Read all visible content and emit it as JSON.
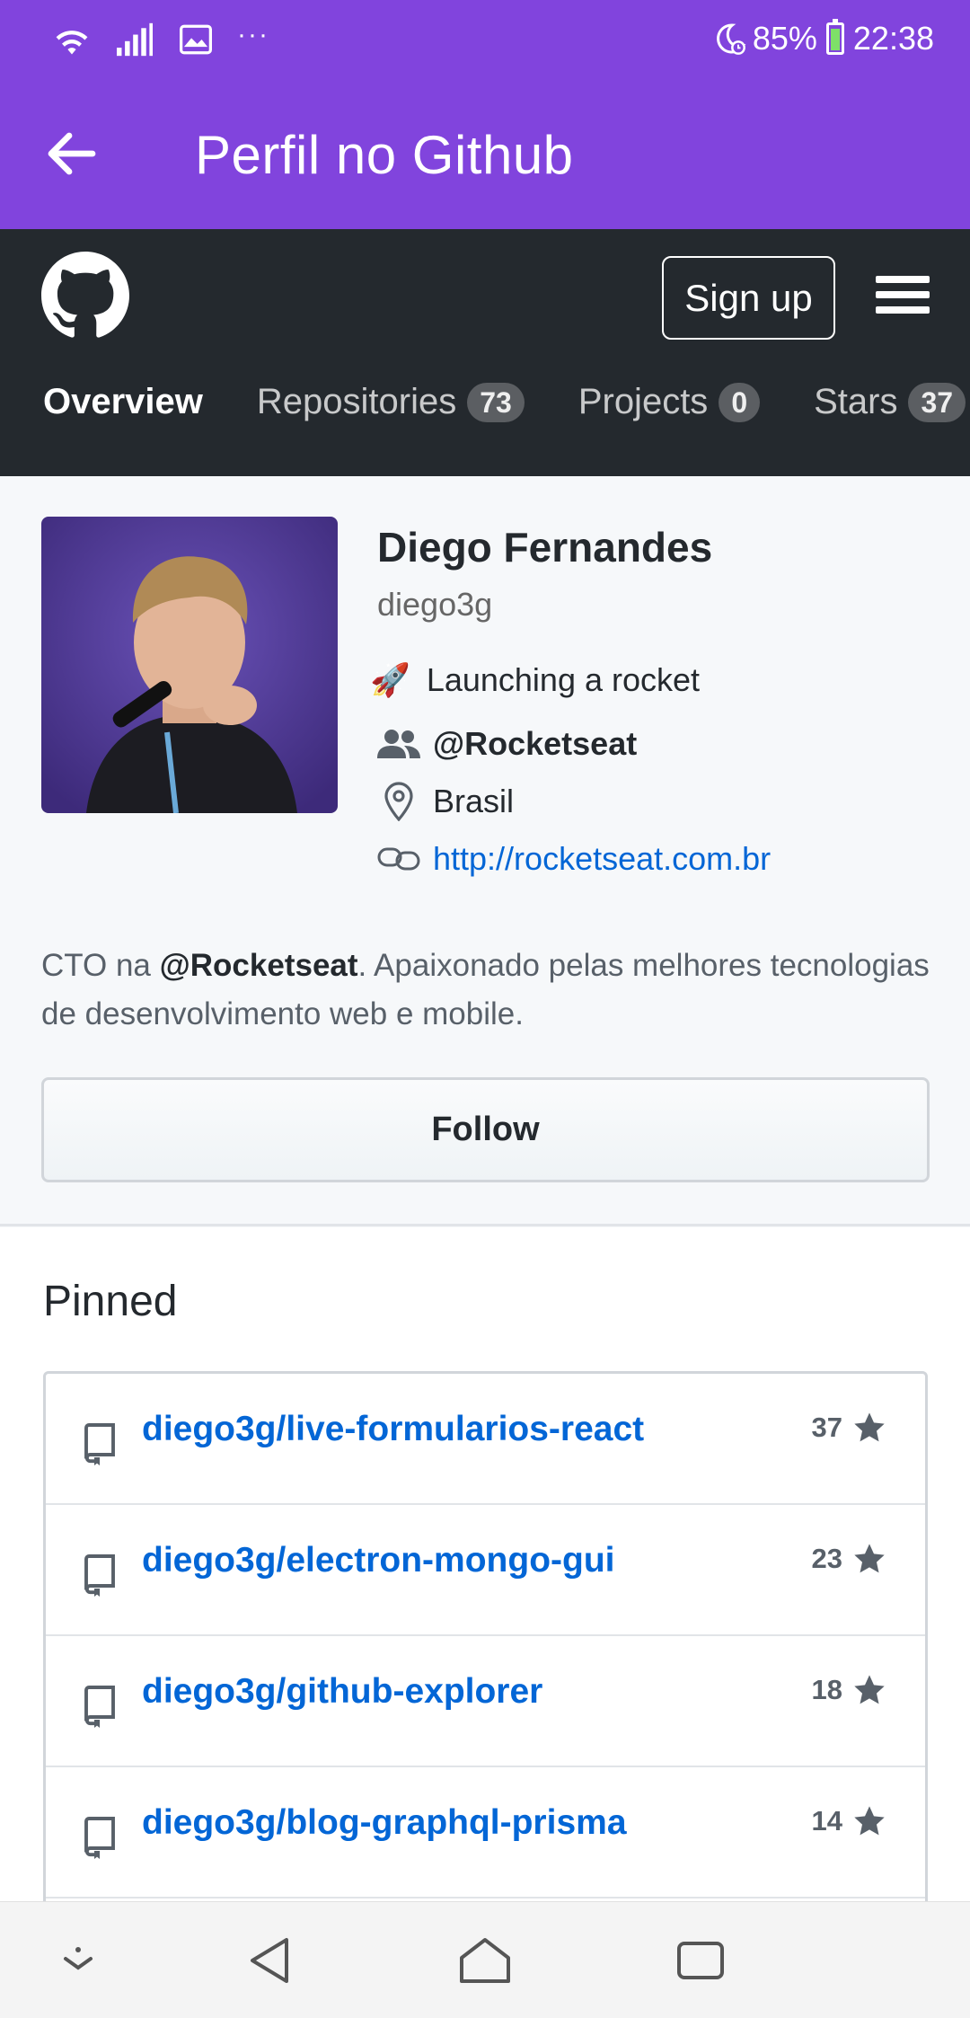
{
  "status_bar": {
    "battery_pct": "85%",
    "time": "22:38",
    "dots": "···",
    "icons": [
      "wifi-icon",
      "signal-icon",
      "image-icon",
      "more-dots-icon",
      "moon-alarm-icon",
      "battery-charging-icon"
    ]
  },
  "app_bar": {
    "title": "Perfil no Github"
  },
  "gh_header": {
    "signup_label": "Sign up",
    "nav": [
      {
        "label": "Overview",
        "count": null
      },
      {
        "label": "Repositories",
        "count": "73"
      },
      {
        "label": "Projects",
        "count": "0"
      },
      {
        "label": "Stars",
        "count": "37"
      }
    ]
  },
  "profile": {
    "name": "Diego Fernandes",
    "login": "diego3g",
    "status": "Launching a rocket",
    "status_emoji": "🚀",
    "organization": "@Rocketseat",
    "location": "Brasil",
    "website": "http://rocketseat.com.br",
    "bio_prefix": "CTO na ",
    "bio_org": "@Rocketseat",
    "bio_suffix": ". Apaixonado pelas melhores tecnologias de desenvolvimento web e mobile.",
    "follow_label": "Follow"
  },
  "pinned": {
    "title": "Pinned",
    "items": [
      {
        "name": "diego3g/live-formularios-react",
        "stars": "37"
      },
      {
        "name": "diego3g/electron-mongo-gui",
        "stars": "23"
      },
      {
        "name": "diego3g/github-explorer",
        "stars": "18"
      },
      {
        "name": "diego3g/blog-graphql-prisma",
        "stars": "14"
      },
      {
        "name": "",
        "stars": ""
      }
    ]
  },
  "colors": {
    "app_bar": "#8144dd",
    "gh_header": "#24292e",
    "link": "#0366d6"
  }
}
